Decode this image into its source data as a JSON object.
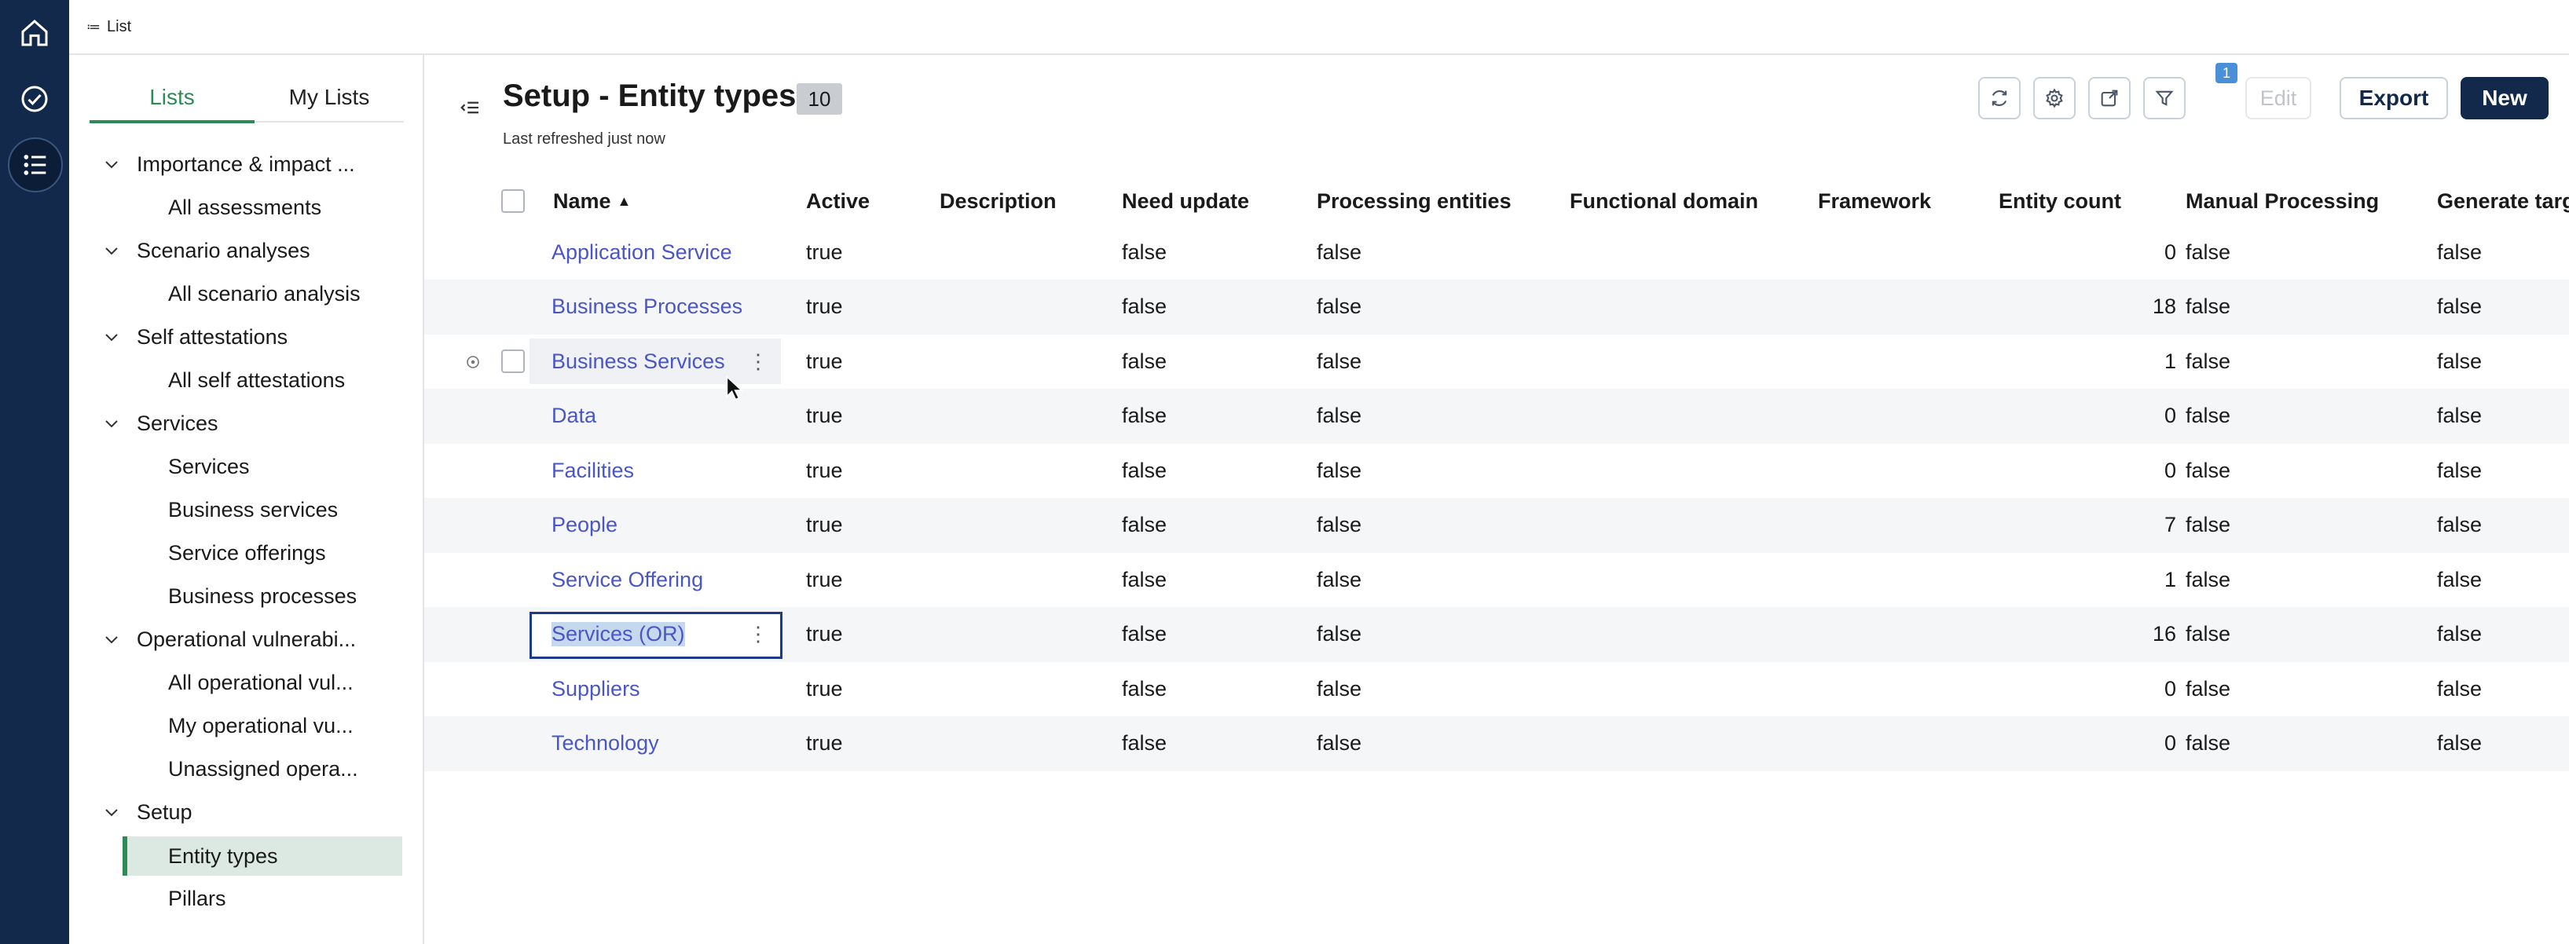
{
  "topbar": {
    "breadcrumb": "List"
  },
  "sidebar": {
    "tabs": [
      {
        "label": "Lists",
        "active": true
      },
      {
        "label": "My Lists",
        "active": false
      }
    ],
    "groups": [
      {
        "label": "Importance & impact ...",
        "children": [
          "All assessments"
        ]
      },
      {
        "label": "Scenario analyses",
        "children": [
          "All scenario analysis"
        ]
      },
      {
        "label": "Self attestations",
        "children": [
          "All self attestations"
        ]
      },
      {
        "label": "Services",
        "children": [
          "Services",
          "Business services",
          "Service offerings",
          "Business processes"
        ]
      },
      {
        "label": "Operational vulnerabi...",
        "children": [
          "All operational vul...",
          "My operational vu...",
          "Unassigned opera..."
        ]
      },
      {
        "label": "Setup",
        "children": [
          "Entity types",
          "Pillars"
        ]
      }
    ],
    "selected_item": "Entity types"
  },
  "header": {
    "title": "Setup - Entity types",
    "count": "10",
    "last_refreshed": "Last refreshed just now"
  },
  "toolbar": {
    "refresh_icon": "refresh-icon",
    "settings_icon": "gear-icon",
    "share_icon": "share-icon",
    "filter_icon": "filter-icon",
    "filter_count": "1",
    "edit_label": "Edit",
    "export_label": "Export",
    "new_label": "New",
    "accent_color": "#13294b"
  },
  "table": {
    "columns": [
      "Name",
      "Active",
      "Description",
      "Need update",
      "Processing entities",
      "Functional domain",
      "Framework",
      "Entity count",
      "Manual Processing",
      "Generate targ"
    ],
    "sort": {
      "column": "Name",
      "direction": "ascending"
    },
    "rows": [
      {
        "name": "Application Service",
        "active": "true",
        "description": "",
        "need_update": "false",
        "processing_entities": "false",
        "functional_domain": "",
        "framework": "",
        "entity_count": "0",
        "manual_processing": "false",
        "generate_targets": "false"
      },
      {
        "name": "Business Processes",
        "active": "true",
        "description": "",
        "need_update": "false",
        "processing_entities": "false",
        "functional_domain": "",
        "framework": "",
        "entity_count": "18",
        "manual_processing": "false",
        "generate_targets": "false"
      },
      {
        "name": "Business Services",
        "active": "true",
        "description": "",
        "need_update": "false",
        "processing_entities": "false",
        "functional_domain": "",
        "framework": "",
        "entity_count": "1",
        "manual_processing": "false",
        "generate_targets": "false"
      },
      {
        "name": "Data",
        "active": "true",
        "description": "",
        "need_update": "false",
        "processing_entities": "false",
        "functional_domain": "",
        "framework": "",
        "entity_count": "0",
        "manual_processing": "false",
        "generate_targets": "false"
      },
      {
        "name": "Facilities",
        "active": "true",
        "description": "",
        "need_update": "false",
        "processing_entities": "false",
        "functional_domain": "",
        "framework": "",
        "entity_count": "0",
        "manual_processing": "false",
        "generate_targets": "false"
      },
      {
        "name": "People",
        "active": "true",
        "description": "",
        "need_update": "false",
        "processing_entities": "false",
        "functional_domain": "",
        "framework": "",
        "entity_count": "7",
        "manual_processing": "false",
        "generate_targets": "false"
      },
      {
        "name": "Service Offering",
        "active": "true",
        "description": "",
        "need_update": "false",
        "processing_entities": "false",
        "functional_domain": "",
        "framework": "",
        "entity_count": "1",
        "manual_processing": "false",
        "generate_targets": "false"
      },
      {
        "name": "Services (OR)",
        "active": "true",
        "description": "",
        "need_update": "false",
        "processing_entities": "false",
        "functional_domain": "",
        "framework": "",
        "entity_count": "16",
        "manual_processing": "false",
        "generate_targets": "false"
      },
      {
        "name": "Suppliers",
        "active": "true",
        "description": "",
        "need_update": "false",
        "processing_entities": "false",
        "functional_domain": "",
        "framework": "",
        "entity_count": "0",
        "manual_processing": "false",
        "generate_targets": "false"
      },
      {
        "name": "Technology",
        "active": "true",
        "description": "",
        "need_update": "false",
        "processing_entities": "false",
        "functional_domain": "",
        "framework": "",
        "entity_count": "0",
        "manual_processing": "false",
        "generate_targets": "false"
      }
    ]
  }
}
